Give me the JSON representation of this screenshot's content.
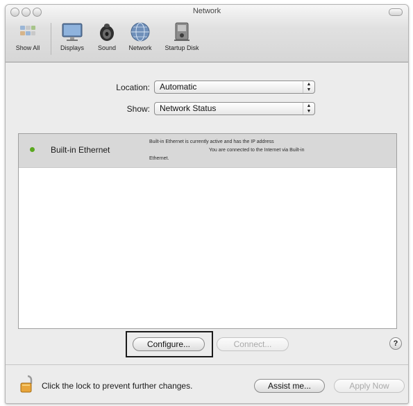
{
  "window": {
    "title": "Network"
  },
  "toolbar": {
    "items": [
      {
        "label": "Show All",
        "icon": "show-all-icon"
      },
      {
        "label": "Displays",
        "icon": "displays-icon"
      },
      {
        "label": "Sound",
        "icon": "sound-icon"
      },
      {
        "label": "Network",
        "icon": "network-icon"
      },
      {
        "label": "Startup Disk",
        "icon": "startup-disk-icon"
      }
    ]
  },
  "location": {
    "label": "Location:",
    "value": "Automatic"
  },
  "show": {
    "label": "Show:",
    "value": "Network Status"
  },
  "status_list": {
    "rows": [
      {
        "name": "Built-in Ethernet",
        "status_color": "#5aa81f",
        "description_line1": "Built-in Ethernet is currently active and has the IP address",
        "description_line2": "You are connected to the Internet via Built-in",
        "description_line3": "Ethernet."
      }
    ]
  },
  "buttons": {
    "configure": "Configure...",
    "connect": "Connect...",
    "help": "?",
    "assist": "Assist me...",
    "apply": "Apply Now"
  },
  "lock": {
    "text": "Click the lock to prevent further changes."
  }
}
